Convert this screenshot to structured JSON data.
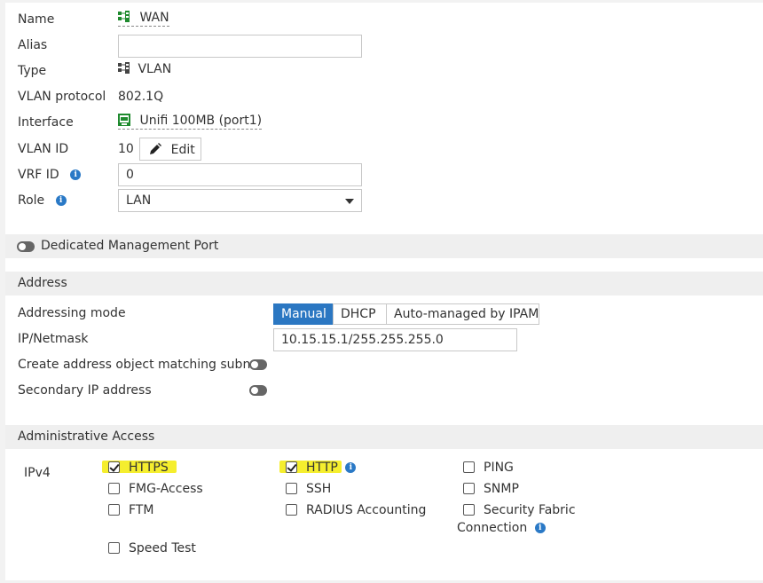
{
  "fields": {
    "name_label": "Name",
    "name_value": "WAN",
    "alias_label": "Alias",
    "alias_value": "",
    "type_label": "Type",
    "type_value": "VLAN",
    "vlan_protocol_label": "VLAN protocol",
    "vlan_protocol_value": "802.1Q",
    "interface_label": "Interface",
    "interface_value": "Unifi 100MB (port1)",
    "vlan_id_label": "VLAN ID",
    "vlan_id_value": "10",
    "edit_label": "Edit",
    "vrf_id_label": "VRF ID",
    "vrf_id_value": "0",
    "role_label": "Role",
    "role_value": "LAN"
  },
  "dedicated_management": {
    "label": "Dedicated Management Port",
    "enabled": false
  },
  "address": {
    "section_title": "Address",
    "addressing_mode_label": "Addressing mode",
    "modes": [
      "Manual",
      "DHCP",
      "Auto-managed by IPAM"
    ],
    "selected_mode": "Manual",
    "ip_netmask_label": "IP/Netmask",
    "ip_netmask_value": "10.15.15.1/255.255.255.0",
    "create_object_label": "Create address object matching subnet",
    "create_object_enabled": false,
    "secondary_ip_label": "Secondary IP address",
    "secondary_ip_enabled": false
  },
  "admin_access": {
    "section_title": "Administrative Access",
    "ipv4_label": "IPv4",
    "options": {
      "https": {
        "label": "HTTPS",
        "checked": true
      },
      "http": {
        "label": "HTTP",
        "checked": true
      },
      "ping": {
        "label": "PING",
        "checked": false
      },
      "fmg_access": {
        "label": "FMG-Access",
        "checked": false
      },
      "ssh": {
        "label": "SSH",
        "checked": false
      },
      "snmp": {
        "label": "SNMP",
        "checked": false
      },
      "ftm": {
        "label": "FTM",
        "checked": false
      },
      "radius_accounting": {
        "label": "RADIUS Accounting",
        "checked": false
      },
      "security_fabric_line1": {
        "label": "Security Fabric",
        "checked": false
      },
      "security_fabric_line2": "Connection",
      "speed_test": {
        "label": "Speed Test",
        "checked": false
      }
    }
  },
  "colors": {
    "accent": "#2b77c2",
    "highlight": "#f5ee2e",
    "section_bg": "#efefef",
    "info_icon": "#2a79c6",
    "interface_icon": "#1f8a2e"
  }
}
